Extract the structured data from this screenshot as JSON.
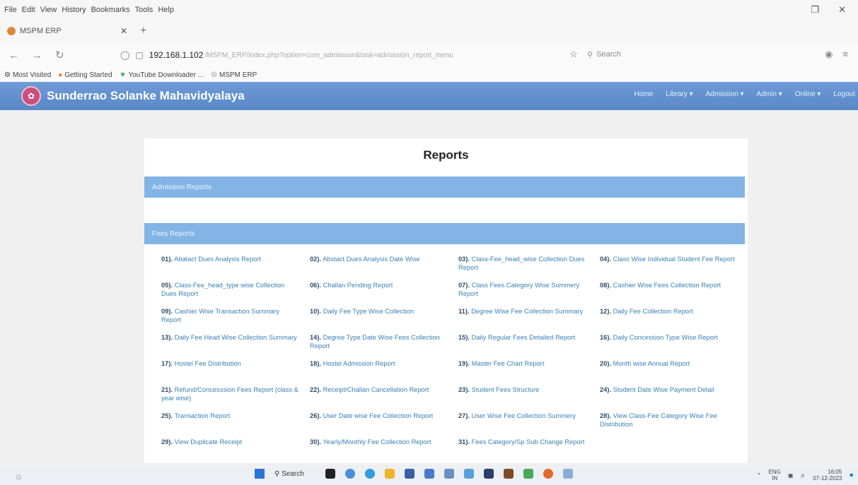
{
  "browser": {
    "menu": [
      "File",
      "Edit",
      "View",
      "History",
      "Bookmarks",
      "Tools",
      "Help"
    ],
    "tab_title": "MSPM ERP",
    "url_host": "192.168.1.102",
    "url_path": "/MSPM_ERP/index.php?option=com_admission&task=admission_report_menu",
    "search_placeholder": "Search",
    "bookmarks": [
      "Most Visited",
      "Getting Started",
      "YouTube Downloader ...",
      "MSPM ERP"
    ]
  },
  "app": {
    "title": "Sunderrao Solanke Mahavidyalaya",
    "nav": [
      "Home",
      "Library ▾",
      "Admission ▾",
      "Admin ▾",
      "Online ▾",
      "Logout"
    ]
  },
  "page": {
    "title": "Reports",
    "admission_section": "Admission Reports",
    "fees_section": "Fees Reports"
  },
  "fees_reports": [
    {
      "num": "01).",
      "label": "Abatact Dues Analysis Report"
    },
    {
      "num": "02).",
      "label": "Abstact Dues Analysis Date Wise"
    },
    {
      "num": "03).",
      "label": "Class-Fee_head_wise Collection Dues Report"
    },
    {
      "num": "04).",
      "label": "Class Wise Individual Student Fee Report"
    },
    {
      "num": "05).",
      "label": "Class-Fee_head_type wise Collection Dues Report"
    },
    {
      "num": "06).",
      "label": "Challan Pending Report"
    },
    {
      "num": "07).",
      "label": "Class Fees Category Wise Summery Report"
    },
    {
      "num": "08).",
      "label": "Cashier Wise Fees Collection Report"
    },
    {
      "num": "09).",
      "label": "Cashier Wise Transaction Summary Report"
    },
    {
      "num": "10).",
      "label": "Daily Fee Type Wise Collection"
    },
    {
      "num": "11).",
      "label": "Degree Wise Fee Collection Summary"
    },
    {
      "num": "12).",
      "label": "Daily Fee Collection Report"
    },
    {
      "num": "13).",
      "label": "Daily Fee Head Wise Collection Summary"
    },
    {
      "num": "14).",
      "label": "Degree Type Date Wise Fees Collection Report"
    },
    {
      "num": "15).",
      "label": "Daily Regular Fees Detailed Report"
    },
    {
      "num": "16).",
      "label": "Daily Concession Type Wise Report"
    },
    {
      "num": "17).",
      "label": "Hostel Fee Distribution"
    },
    {
      "num": "18).",
      "label": "Hostel Admission Report"
    },
    {
      "num": "19).",
      "label": "Master Fee Chart Report"
    },
    {
      "num": "20).",
      "label": "Month wise Annual Report"
    },
    {
      "num": "21).",
      "label": "Refund/Concesssion Fees Report (class & year wise)"
    },
    {
      "num": "22).",
      "label": "Receipt/Challan Cancellation Report"
    },
    {
      "num": "23).",
      "label": "Student Fees Structure"
    },
    {
      "num": "24).",
      "label": "Student Date Wise Payment Detail"
    },
    {
      "num": "25).",
      "label": "Transaction Report"
    },
    {
      "num": "26).",
      "label": "User Date wise Fee Collection Report"
    },
    {
      "num": "27).",
      "label": "User Wise Fee Collection Summery"
    },
    {
      "num": "28).",
      "label": "View Class-Fee Category Wise Fee Distribution"
    },
    {
      "num": "29).",
      "label": "View Duplicate Receipt"
    },
    {
      "num": "30).",
      "label": "Yearly/Monthly Fee Collection Report"
    },
    {
      "num": "31).",
      "label": "Fees Category/Sp Sub Change Report"
    }
  ],
  "taskbar": {
    "search_label": "Search",
    "lang_line1": "ENG",
    "lang_line2": "IN",
    "time": "16:05",
    "date": "07-12-2023"
  }
}
